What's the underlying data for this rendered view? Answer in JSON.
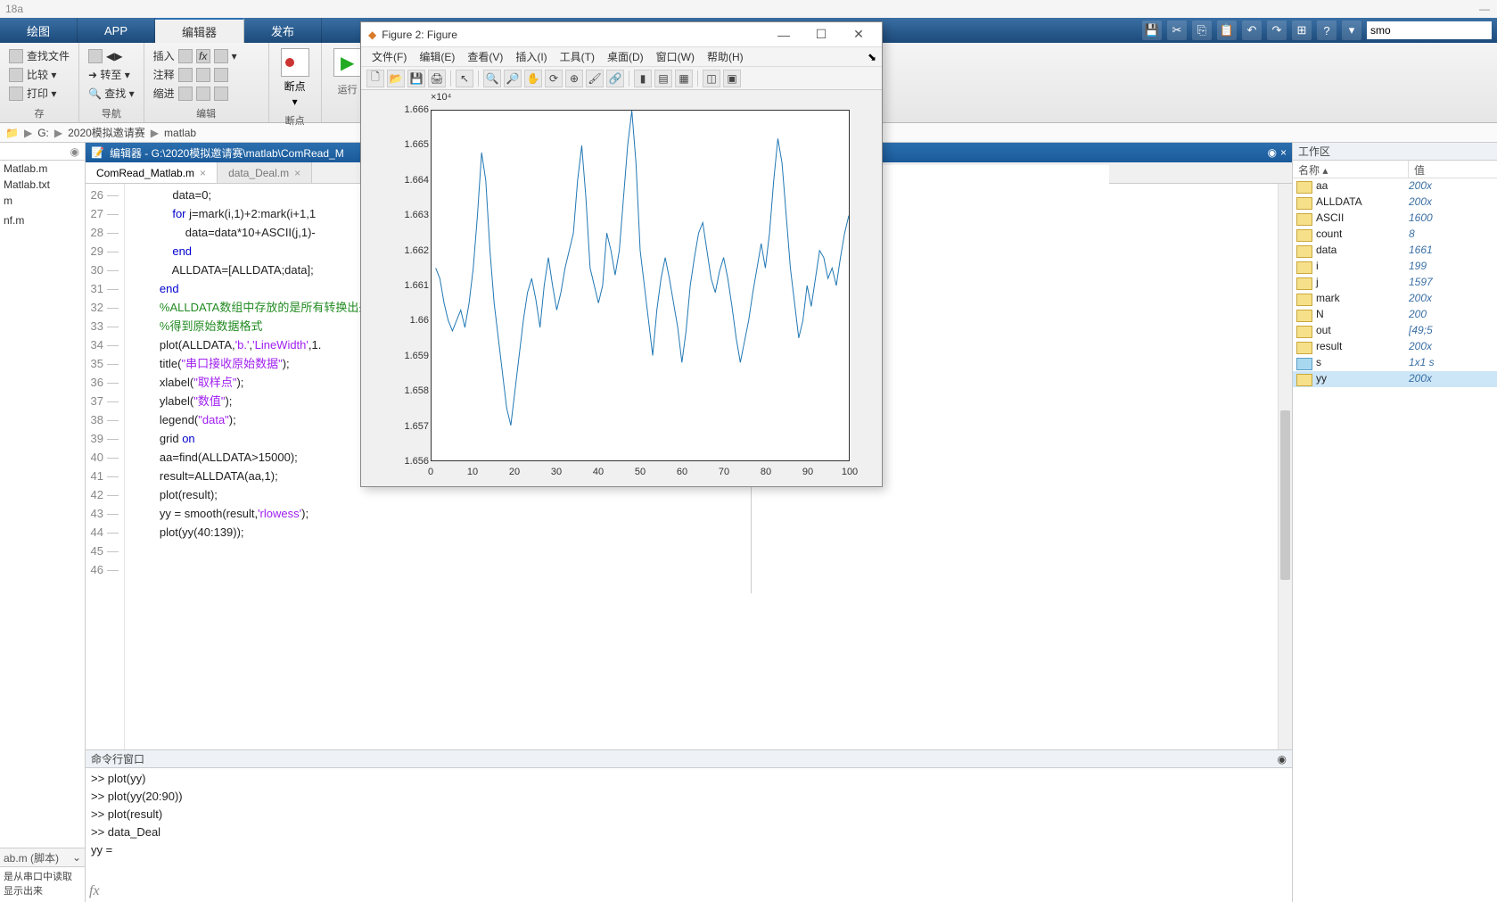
{
  "app_title": "18a",
  "main_tabs": [
    "绘图",
    "APP",
    "编辑器",
    "发布"
  ],
  "main_tab_active": 2,
  "search_value": "smo",
  "ribbon": {
    "groups": [
      {
        "label": "存",
        "buttons": [
          "查找文件",
          "比较 ▾",
          "打印 ▾"
        ]
      },
      {
        "label": "导航",
        "buttons": [
          "◀▶",
          "➜ 转至 ▾",
          "🔍 查找 ▾"
        ]
      },
      {
        "label": "编辑",
        "head": [
          "插入",
          "注释",
          "缩进"
        ]
      },
      {
        "label": "断点",
        "big": "断点"
      },
      {
        "label": "运行",
        "big": "▶"
      }
    ]
  },
  "breadcrumb": [
    "G:",
    "2020模拟邀请赛",
    "matlab"
  ],
  "sidebar_files": [
    "Matlab.m",
    "Matlab.txt",
    "m",
    "",
    "nf.m"
  ],
  "script_header": "ab.m (脚本)",
  "script_desc": "是从串口中读取\n显示出来",
  "editor": {
    "title": "编辑器 - G:\\2020模拟邀请赛\\matlab\\ComRead_M",
    "tabs": [
      {
        "name": "ComRead_Matlab.m",
        "active": true
      },
      {
        "name": "data_Deal.m",
        "active": false
      }
    ],
    "start_line": 26,
    "lines": [
      {
        "n": 26,
        "t": "            data=0;"
      },
      {
        "n": 27,
        "t": "            <kw>for</kw> j=mark(i,1)+2:mark(i+1,1"
      },
      {
        "n": 28,
        "t": "                data=data*10+ASCII(j,1)-"
      },
      {
        "n": 29,
        "t": "            <kw>end</kw>"
      },
      {
        "n": 30,
        "t": "            ALLDATA=[ALLDATA;data];"
      },
      {
        "n": 31,
        "t": "        <kw>end</kw>"
      },
      {
        "n": 32,
        "t": "        <cm>%ALLDATA数组中存放的是所有转换出来"
      },
      {
        "n": 33,
        "t": "        <cm>%得到原始数据格式</cm>"
      },
      {
        "n": 34,
        "t": "        plot(ALLDATA,<str>'b.'</str>,<str>'LineWidth'</str>,1."
      },
      {
        "n": 35,
        "t": "        title(<str>\"串口接收原始数据\"</str>);"
      },
      {
        "n": 36,
        "t": "        xlabel(<str>\"取样点\"</str>);"
      },
      {
        "n": 37,
        "t": "        ylabel(<str>\"数值\"</str>);"
      },
      {
        "n": 38,
        "t": "        legend(<str>\"data\"</str>);"
      },
      {
        "n": 39,
        "t": "        grid <kw>on</kw>"
      },
      {
        "n": 40,
        "t": ""
      },
      {
        "n": 41,
        "t": "        aa=find(ALLDATA>15000);"
      },
      {
        "n": 42,
        "t": "        result=ALLDATA(aa,1);"
      },
      {
        "n": 43,
        "t": "        plot(result);"
      },
      {
        "n": 44,
        "t": ""
      },
      {
        "n": 45,
        "t": "        yy = smooth(result,<str>'rlowess'</str>);"
      },
      {
        "n": 46,
        "t": "        plot(yy(40:139));"
      }
    ]
  },
  "cmd_title": "命令行窗口",
  "cmd_lines": [
    ">> plot(yy)",
    ">>  plot(yy(20:90))",
    ">> plot(result)",
    ">> data_Deal",
    "",
    "yy ="
  ],
  "workspace": {
    "title": "工作区",
    "cols": [
      "名称 ▴",
      "值"
    ],
    "rows": [
      {
        "n": "aa",
        "v": "200x",
        "sel": false
      },
      {
        "n": "ALLDATA",
        "v": "200x",
        "sel": false
      },
      {
        "n": "ASCII",
        "v": "1600",
        "sel": false
      },
      {
        "n": "count",
        "v": "8",
        "sel": false
      },
      {
        "n": "data",
        "v": "1661",
        "sel": false
      },
      {
        "n": "i",
        "v": "199",
        "sel": false
      },
      {
        "n": "j",
        "v": "1597",
        "sel": false
      },
      {
        "n": "mark",
        "v": "200x",
        "sel": false
      },
      {
        "n": "N",
        "v": "200",
        "sel": false
      },
      {
        "n": "out",
        "v": "[49;5",
        "sel": false
      },
      {
        "n": "result",
        "v": "200x",
        "sel": false
      },
      {
        "n": "s",
        "v": "1x1 s",
        "sel": false,
        "icon": "s"
      },
      {
        "n": "yy",
        "v": "200x",
        "sel": true
      }
    ]
  },
  "figure": {
    "title": "Figure 2: Figure",
    "menu": [
      "文件(F)",
      "编辑(E)",
      "查看(V)",
      "插入(I)",
      "工具(T)",
      "桌面(D)",
      "窗口(W)",
      "帮助(H)"
    ]
  },
  "chart_data": {
    "type": "line",
    "title": "",
    "xlabel": "",
    "ylabel": "",
    "y_exponent": "×10⁴",
    "xlim": [
      0,
      100
    ],
    "ylim": [
      1.656,
      1.666
    ],
    "x_ticks": [
      0,
      10,
      20,
      30,
      40,
      50,
      60,
      70,
      80,
      90,
      100
    ],
    "y_ticks": [
      1.656,
      1.657,
      1.658,
      1.659,
      1.66,
      1.661,
      1.662,
      1.663,
      1.664,
      1.665,
      1.666
    ],
    "x": [
      1,
      2,
      3,
      4,
      5,
      6,
      7,
      8,
      9,
      10,
      11,
      12,
      13,
      14,
      15,
      16,
      17,
      18,
      19,
      20,
      21,
      22,
      23,
      24,
      25,
      26,
      27,
      28,
      29,
      30,
      31,
      32,
      33,
      34,
      35,
      36,
      37,
      38,
      39,
      40,
      41,
      42,
      43,
      44,
      45,
      46,
      47,
      48,
      49,
      50,
      51,
      52,
      53,
      54,
      55,
      56,
      57,
      58,
      59,
      60,
      61,
      62,
      63,
      64,
      65,
      66,
      67,
      68,
      69,
      70,
      71,
      72,
      73,
      74,
      75,
      76,
      77,
      78,
      79,
      80,
      81,
      82,
      83,
      84,
      85,
      86,
      87,
      88,
      89,
      90,
      91,
      92,
      93,
      94,
      95,
      96,
      97,
      98,
      99,
      100
    ],
    "y": [
      1.6615,
      1.6612,
      1.6605,
      1.66,
      1.6597,
      1.66,
      1.6603,
      1.6598,
      1.6605,
      1.6615,
      1.663,
      1.6648,
      1.664,
      1.662,
      1.6605,
      1.6595,
      1.6585,
      1.6575,
      1.657,
      1.658,
      1.659,
      1.66,
      1.6608,
      1.6612,
      1.6606,
      1.6598,
      1.661,
      1.6618,
      1.661,
      1.6603,
      1.6608,
      1.6615,
      1.662,
      1.6625,
      1.664,
      1.665,
      1.6635,
      1.6615,
      1.661,
      1.6605,
      1.661,
      1.6625,
      1.662,
      1.6613,
      1.662,
      1.6635,
      1.665,
      1.666,
      1.6645,
      1.662,
      1.661,
      1.66,
      1.659,
      1.6603,
      1.6612,
      1.6618,
      1.6612,
      1.6605,
      1.6598,
      1.6588,
      1.6597,
      1.661,
      1.6618,
      1.6625,
      1.6628,
      1.662,
      1.6612,
      1.6608,
      1.6614,
      1.6618,
      1.6612,
      1.6604,
      1.6595,
      1.6588,
      1.6594,
      1.66,
      1.6608,
      1.6615,
      1.6622,
      1.6615,
      1.6625,
      1.664,
      1.6652,
      1.6645,
      1.663,
      1.6615,
      1.6605,
      1.6595,
      1.66,
      1.661,
      1.6604,
      1.6612,
      1.662,
      1.6618,
      1.6612,
      1.6615,
      1.661,
      1.6618,
      1.6625,
      1.663
    ]
  }
}
